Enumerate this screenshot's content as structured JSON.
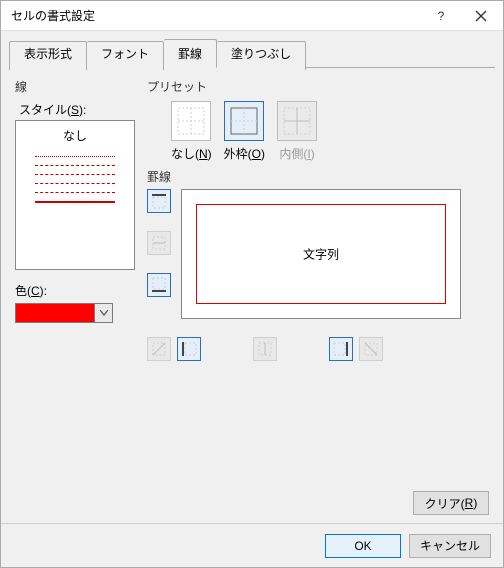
{
  "title": "セルの書式設定",
  "tabs": {
    "t1": "表示形式",
    "t2": "フォント",
    "t3": "罫線",
    "t4": "塗りつぶし"
  },
  "left": {
    "group": "線",
    "style_label_pre": "スタイル(",
    "style_key": "S",
    "style_label_post": "):",
    "style_none": "なし",
    "color_label_pre": "色(",
    "color_key": "C",
    "color_label_post": "):",
    "color_value": "#ff0000"
  },
  "right": {
    "preset_group": "プリセット",
    "preset_none_pre": "なし(",
    "preset_none_key": "N",
    "preset_none_post": ")",
    "preset_out_pre": "外枠(",
    "preset_out_key": "O",
    "preset_out_post": ")",
    "preset_in_pre": "内側(",
    "preset_in_key": "I",
    "preset_in_post": ")",
    "border_group": "罫線",
    "preview_text": "文字列"
  },
  "footer": {
    "clear_pre": "クリア(",
    "clear_key": "R",
    "clear_post": ")",
    "ok": "OK",
    "cancel": "キャンセル"
  }
}
